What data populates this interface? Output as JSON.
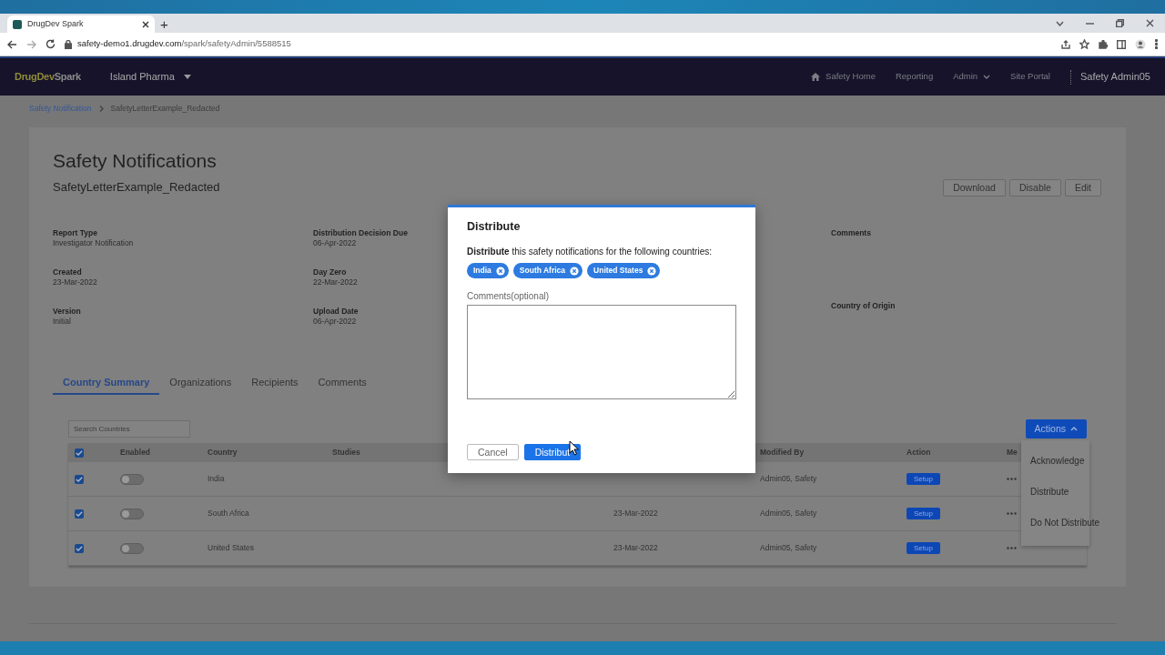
{
  "browser": {
    "tab_title": "DrugDev Spark",
    "new_tab": "+",
    "url_host": "safety-demo1.drugdev.com",
    "url_path": "/spark/safetyAdmin/5588515"
  },
  "navbar": {
    "logo_1": "DrugDev",
    "logo_2": "Spark",
    "org": "Island Pharma",
    "links": [
      {
        "label": "Safety Home",
        "kind": "home"
      },
      {
        "label": "Reporting",
        "kind": "plain"
      },
      {
        "label": "Admin",
        "kind": "dropdown"
      },
      {
        "label": "Site Portal",
        "kind": "plain"
      }
    ],
    "user": "Safety Admin05"
  },
  "breadcrumb": [
    {
      "label": "Safety Notification",
      "kind": "link"
    },
    {
      "label": "SafetyLetterExample_Redacted",
      "kind": "current"
    }
  ],
  "page": {
    "title": "Safety Notifications",
    "subtitle": "SafetyLetterExample_Redacted",
    "buttons": [
      "Download",
      "Disable",
      "Edit"
    ]
  },
  "details": [
    [
      {
        "label": "Report Type",
        "value": "Investigator Notification"
      },
      {
        "label": "Created",
        "value": "23-Mar-2022"
      },
      {
        "label": "Version",
        "value": "Initial"
      }
    ],
    [
      {
        "label": "Distribution Decision Due",
        "value": "06-Apr-2022"
      },
      {
        "label": "Day Zero",
        "value": "22-Mar-2022"
      },
      {
        "label": "Upload Date",
        "value": "06-Apr-2022"
      }
    ],
    [
      {
        "label": "Comments"
      },
      {
        "label": "Country of Origin"
      }
    ]
  ],
  "tabs": [
    {
      "label": "Country Summary",
      "selected": true
    },
    {
      "label": "Organizations",
      "selected": false
    },
    {
      "label": "Recipients",
      "selected": false
    },
    {
      "label": "Comments",
      "selected": false
    }
  ],
  "search": {
    "placeholder": "Search Countries"
  },
  "actions": {
    "label": "Actions",
    "expanded": true,
    "items": [
      "Acknowledge",
      "Distribute",
      "Do Not Distribute"
    ]
  },
  "table": {
    "select_all": true,
    "columns": [
      "Enabled",
      "Country",
      "Studies",
      "",
      "Modified By",
      "Action",
      "Me"
    ],
    "rows": [
      {
        "checked": true,
        "enabled": false,
        "country": "India",
        "modified_by": "Admin05, Safety",
        "action": "Setup"
      },
      {
        "checked": true,
        "enabled": false,
        "country": "South Africa",
        "date": "23-Mar-2022",
        "modified_by": "Admin05, Safety",
        "action": "Setup"
      },
      {
        "checked": true,
        "enabled": false,
        "country": "United States",
        "date": "23-Mar-2022",
        "modified_by": "Admin05, Safety",
        "action": "Setup"
      }
    ]
  },
  "modal": {
    "title": "Distribute",
    "message": "**Distribute** this safety notifications for the following countries:",
    "chips": [
      "India",
      "South Africa",
      "United States"
    ],
    "comments_label": "Comments(optional)",
    "buttons": [
      {
        "label": "Cancel",
        "kind": "secondary"
      },
      {
        "label": "Distribut",
        "kind": "primary"
      }
    ]
  }
}
